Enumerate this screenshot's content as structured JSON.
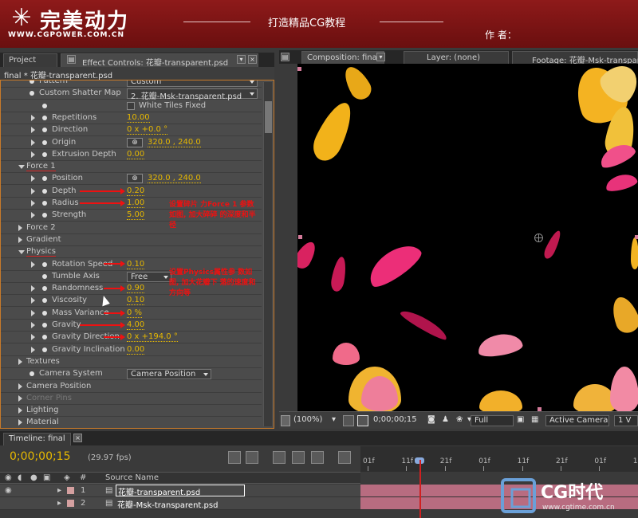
{
  "banner": {
    "logo": "完美动力",
    "url": "WWW.CGPOWER.COM.CN",
    "title": "打造精品CG教程",
    "author": "作 者："
  },
  "left_panel": {
    "tabs": [
      "Project",
      "Effect Controls: 花瓣-transparent.psd"
    ],
    "subtitle": "final * 花瓣-transparent.psd"
  },
  "properties": [
    {
      "label": "Pattern",
      "dropdown": "Custom"
    },
    {
      "label": "Custom Shatter Map",
      "dropdown": "2. 花瓣-Msk-transparent.psd"
    },
    {
      "label": "",
      "checkbox": "White Tiles Fixed"
    },
    {
      "label": "Repetitions",
      "value": "10.00"
    },
    {
      "label": "Direction",
      "value": "0 x +0.0 °"
    },
    {
      "label": "Origin",
      "value": "320.0 , 240.0"
    },
    {
      "label": "Extrusion Depth",
      "value": "0.00"
    },
    {
      "label": "Force 1",
      "group": true
    },
    {
      "label": "Position",
      "value": "320.0 , 240.0"
    },
    {
      "label": "Depth",
      "value": "0.20"
    },
    {
      "label": "Radius",
      "value": "1.00"
    },
    {
      "label": "Strength",
      "value": "5.00"
    },
    {
      "label": "Force 2",
      "group": true
    },
    {
      "label": "Gradient",
      "group": true
    },
    {
      "label": "Physics",
      "group": true
    },
    {
      "label": "Rotation Speed",
      "value": "0.10"
    },
    {
      "label": "Tumble Axis",
      "dropdown": "Free"
    },
    {
      "label": "Randomness",
      "value": "0.90"
    },
    {
      "label": "Viscosity",
      "value": "0.10"
    },
    {
      "label": "Mass Variance",
      "value": "0 %"
    },
    {
      "label": "Gravity",
      "value": "4.00"
    },
    {
      "label": "Gravity Direction",
      "value": "0 x +194.0 °"
    },
    {
      "label": "Gravity Inclination",
      "value": "0.00"
    },
    {
      "label": "Textures",
      "group": true
    },
    {
      "label": "Camera System",
      "dropdown": "Camera Position"
    },
    {
      "label": "Camera Position",
      "group": true
    },
    {
      "label": "Corner Pins",
      "group": true
    },
    {
      "label": "Lighting",
      "group": true
    },
    {
      "label": "Material",
      "group": true
    }
  ],
  "annotations": {
    "force": "设置碎片 力Force 1 参数如图, 加大碎碎 的深度和半径",
    "physics": "设置Physics属性参 数如图, 加大花瓣下 落的速度和方向等"
  },
  "comp_panel": {
    "tabs": [
      "Composition: final",
      "Layer: (none)",
      "Footage: 花瓣-Msk-transpar"
    ],
    "zoom": "(100%)",
    "timecode": "0;00;00;15",
    "resolution": "Full",
    "camera": "Active Camera",
    "views": "1 V"
  },
  "timeline": {
    "tab": "Timeline: final",
    "time": "0;00;00;15",
    "fps": "(29.97 fps)",
    "columns": {
      "num": "#",
      "source": "Source Name"
    },
    "ticks": [
      "01f",
      "11f",
      "21f",
      "01f",
      "11f",
      "21f",
      "01f",
      "11f"
    ],
    "layers": [
      {
        "num": "1",
        "name": "花瓣-transparent.psd"
      },
      {
        "num": "2",
        "name": "花瓣-Msk-transparent.psd"
      }
    ]
  },
  "watermark": {
    "brand": "CG时代",
    "url": "www.cgtime.com.cn"
  },
  "colors": {
    "banner": "#7a1414",
    "value": "#e6b800",
    "annotation": "#e11111",
    "panel_border": "#c87a2a"
  }
}
